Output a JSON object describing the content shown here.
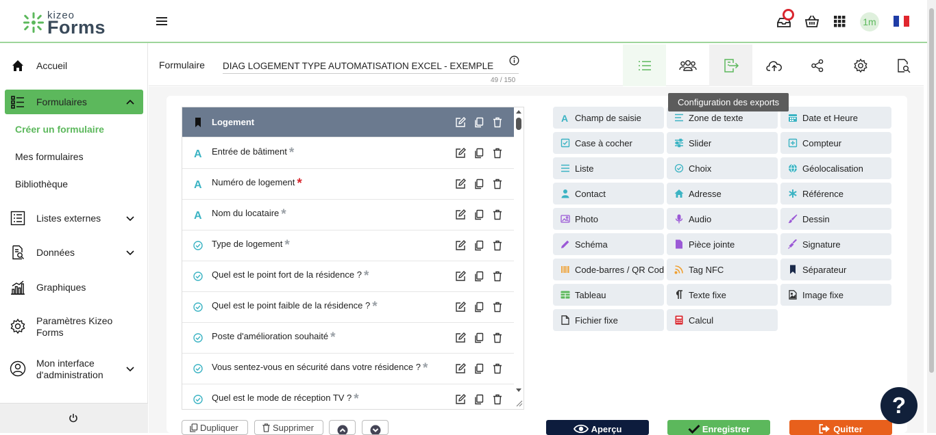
{
  "brand": {
    "line1": "kizeo",
    "line2": "Forms"
  },
  "topbar": {
    "avatar_text": "1m"
  },
  "sidebar": {
    "accueil": "Accueil",
    "formulaires": "Formulaires",
    "sub_creer": "Créer un formulaire",
    "sub_mes": "Mes formulaires",
    "sub_biblio": "Bibliothèque",
    "listes": "Listes externes",
    "donnees": "Données",
    "graphiques": "Graphiques",
    "params_l1": "Paramètres Kizeo",
    "params_l2": "Forms",
    "admin_l1": "Mon interface",
    "admin_l2": "d'administration"
  },
  "form_header": {
    "label": "Formulaire",
    "name": "DIAG LOGEMENT TYPE AUTOMATISATION EXCEL - EXEMPLE",
    "counter": "49 / 150",
    "tooltip": "Configuration des exports"
  },
  "fields": [
    {
      "label": "Logement",
      "type": "separator",
      "required": false
    },
    {
      "label": "Entrée de bâtiment",
      "type": "text",
      "required": false
    },
    {
      "label": "Numéro de logement",
      "type": "text",
      "required": true
    },
    {
      "label": "Nom du locataire",
      "type": "text",
      "required": false
    },
    {
      "label": "Type de logement",
      "type": "choice",
      "required": false
    },
    {
      "label": "Quel est le point fort de la résidence ?",
      "type": "choice",
      "required": false
    },
    {
      "label": "Quel est le point faible de la résidence ?",
      "type": "choice",
      "required": false
    },
    {
      "label": "Poste d'amélioration souhaité",
      "type": "choice",
      "required": false
    },
    {
      "label": "Vous sentez-vous en sécurité dans votre résidence ?",
      "type": "choice",
      "required": false
    },
    {
      "label": "Quel est le mode de réception TV ?",
      "type": "choice",
      "required": false
    }
  ],
  "palette": [
    {
      "label": "Champ de saisie",
      "icon": "text-a-icon",
      "color": "#3bb3c3"
    },
    {
      "label": "Zone de texte",
      "icon": "paragraph-icon",
      "color": "#3bb3c3"
    },
    {
      "label": "Date et Heure",
      "icon": "calendar-icon",
      "color": "#3bb3c3"
    },
    {
      "label": "Case à cocher",
      "icon": "checkbox-icon",
      "color": "#3bb3c3"
    },
    {
      "label": "Slider",
      "icon": "sliders-icon",
      "color": "#3bb3c3"
    },
    {
      "label": "Compteur",
      "icon": "plus-square-icon",
      "color": "#3bb3c3"
    },
    {
      "label": "Liste",
      "icon": "list-icon",
      "color": "#3bb3c3"
    },
    {
      "label": "Choix",
      "icon": "check-circle-icon",
      "color": "#3bb3c3"
    },
    {
      "label": "Géolocalisation",
      "icon": "globe-icon",
      "color": "#3bb3c3"
    },
    {
      "label": "Contact",
      "icon": "person-icon",
      "color": "#3bb3c3"
    },
    {
      "label": "Adresse",
      "icon": "house-icon",
      "color": "#3bb3c3"
    },
    {
      "label": "Référence",
      "icon": "asterisk-icon",
      "color": "#3bb3c3"
    },
    {
      "label": "Photo",
      "icon": "photo-icon",
      "color": "#9b59d6"
    },
    {
      "label": "Audio",
      "icon": "microphone-icon",
      "color": "#9b59d6"
    },
    {
      "label": "Dessin",
      "icon": "brush-icon",
      "color": "#9b59d6"
    },
    {
      "label": "Schéma",
      "icon": "pencil-icon",
      "color": "#9b59d6"
    },
    {
      "label": "Pièce jointe",
      "icon": "file-icon",
      "color": "#9b59d6"
    },
    {
      "label": "Signature",
      "icon": "signature-icon",
      "color": "#9b59d6"
    },
    {
      "label": "Code-barres / QR Code",
      "icon": "barcode-icon",
      "color": "#f0a030"
    },
    {
      "label": "Tag NFC",
      "icon": "nfc-icon",
      "color": "#f0a030"
    },
    {
      "label": "Séparateur",
      "icon": "bookmark-icon",
      "color": "#1a2a4a"
    },
    {
      "label": "Tableau",
      "icon": "table-icon",
      "color": "#5cb85c"
    },
    {
      "label": "Texte fixe",
      "icon": "pilcrow-icon",
      "color": "#333333"
    },
    {
      "label": "Image fixe",
      "icon": "image-icon",
      "color": "#333333"
    },
    {
      "label": "Fichier fixe",
      "icon": "document-icon",
      "color": "#333333"
    },
    {
      "label": "Calcul",
      "icon": "calculator-icon",
      "color": "#d9262e"
    }
  ],
  "bottom": {
    "dupliquer": "Dupliquer",
    "supprimer": "Supprimer",
    "apercu": "Aperçu",
    "enregistrer": "Enregistrer",
    "quitter": "Quitter"
  },
  "colors": {
    "brand_green": "#5cb85c",
    "separator_row": "#6b7a8f",
    "required_red": "#d9262e",
    "optional_gray": "#9aa0a6",
    "apercu_bg": "#0d1c3d",
    "enregistrer_bg": "#5cb85c",
    "quitter_bg": "#e8601c"
  }
}
